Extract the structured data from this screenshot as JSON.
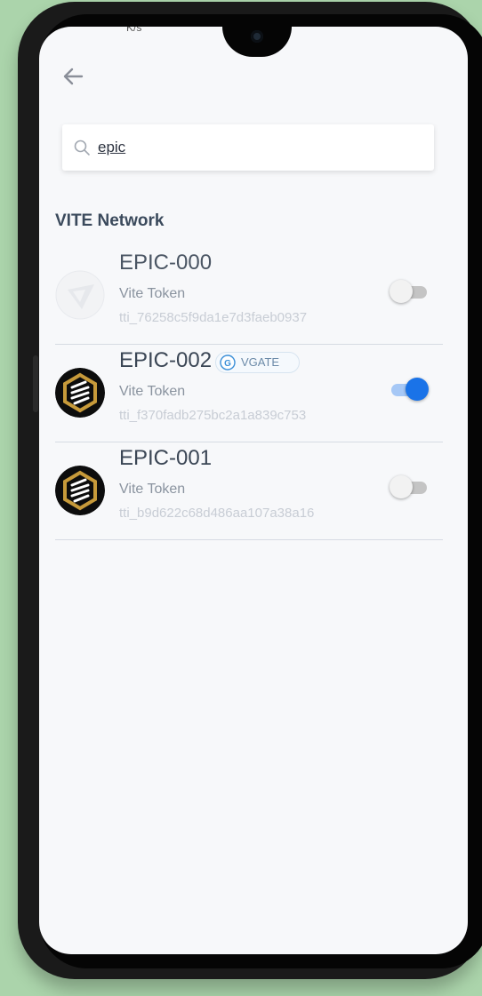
{
  "status_bar": {
    "left_text": "K/s"
  },
  "search": {
    "value": "epic"
  },
  "section": {
    "title": "VITE Network"
  },
  "tokens": [
    {
      "name": "EPIC-000",
      "type": "Vite Token",
      "id": "tti_76258c5f9da1e7d3faeb0937",
      "enabled": false,
      "gateway": null,
      "logo": "vite-logo-faded"
    },
    {
      "name": "EPIC-002",
      "type": "Vite Token",
      "id": "tti_f370fadb275bc2a1a839c753",
      "enabled": true,
      "gateway": "VGATE",
      "logo": "epic-logo"
    },
    {
      "name": "EPIC-001",
      "type": "Vite Token",
      "id": "tti_b9d622c68d486aa107a38a16",
      "enabled": false,
      "gateway": null,
      "logo": "epic-logo"
    }
  ],
  "colors": {
    "accent": "#1a73e8",
    "background": "#f7f8fa",
    "divider": "#d6dbe3"
  },
  "icons": {
    "back": "arrow-left-icon",
    "search": "search-icon",
    "gateway": "vgate-g-icon"
  }
}
